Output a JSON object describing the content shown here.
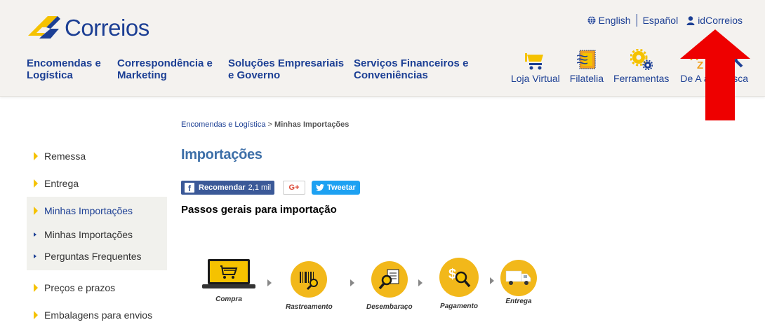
{
  "header": {
    "logo_text": "Correios",
    "top_links": {
      "english": "English",
      "espanol": "Español",
      "id_correios": "idCorreios"
    },
    "main_nav": [
      {
        "line1": "Encomendas e",
        "line2": "Logística"
      },
      {
        "line1": "Correspondência e",
        "line2": "Marketing"
      },
      {
        "line1": "Soluções Empresariais",
        "line2": "e Governo"
      },
      {
        "line1": "Serviços Financeiros e",
        "line2": "Conveniências"
      }
    ],
    "quick_nav": [
      {
        "label": "Loja Virtual",
        "icon": "cart-icon"
      },
      {
        "label": "Filatelia",
        "icon": "stamp-icon"
      },
      {
        "label": "Ferramentas",
        "icon": "gears-icon"
      },
      {
        "label": "De A a Z",
        "icon": "az-icon"
      },
      {
        "label": "Busca",
        "icon": "search-icon"
      }
    ]
  },
  "breadcrumb": {
    "parent": "Encomendas e Logística",
    "separator": ">",
    "current": "Minhas Importações"
  },
  "sidebar": {
    "items": [
      {
        "label": "Remessa"
      },
      {
        "label": "Entrega"
      },
      {
        "label": "Minhas Importações"
      }
    ],
    "sub_items": [
      {
        "label": "Minhas Importações"
      },
      {
        "label": "Perguntas Frequentes"
      }
    ],
    "items_after": [
      {
        "label": "Preços e prazos"
      },
      {
        "label": "Embalagens para envios"
      }
    ]
  },
  "content": {
    "title": "Importações",
    "share": {
      "facebook_label": "Recomendar",
      "facebook_count": "2,1 mil",
      "google_label": "G+",
      "tweet_label": "Tweetar"
    },
    "section_heading": "Passos gerais para importação",
    "steps": [
      {
        "label": "Compra",
        "icon": "laptop-cart-icon"
      },
      {
        "label": "Rastreamento",
        "icon": "barcode-magnifier-icon"
      },
      {
        "label": "Desembaraço",
        "icon": "document-magnifier-icon"
      },
      {
        "label": "Pagamento",
        "icon": "dollar-magnifier-icon"
      },
      {
        "label": "Entrega",
        "icon": "truck-icon"
      }
    ]
  },
  "colors": {
    "brand_blue": "#1c3f94",
    "brand_yellow": "#f5c200",
    "title_blue": "#3d6fa8",
    "header_bg": "#f4f2ef",
    "annotation_red": "#ee0000"
  }
}
